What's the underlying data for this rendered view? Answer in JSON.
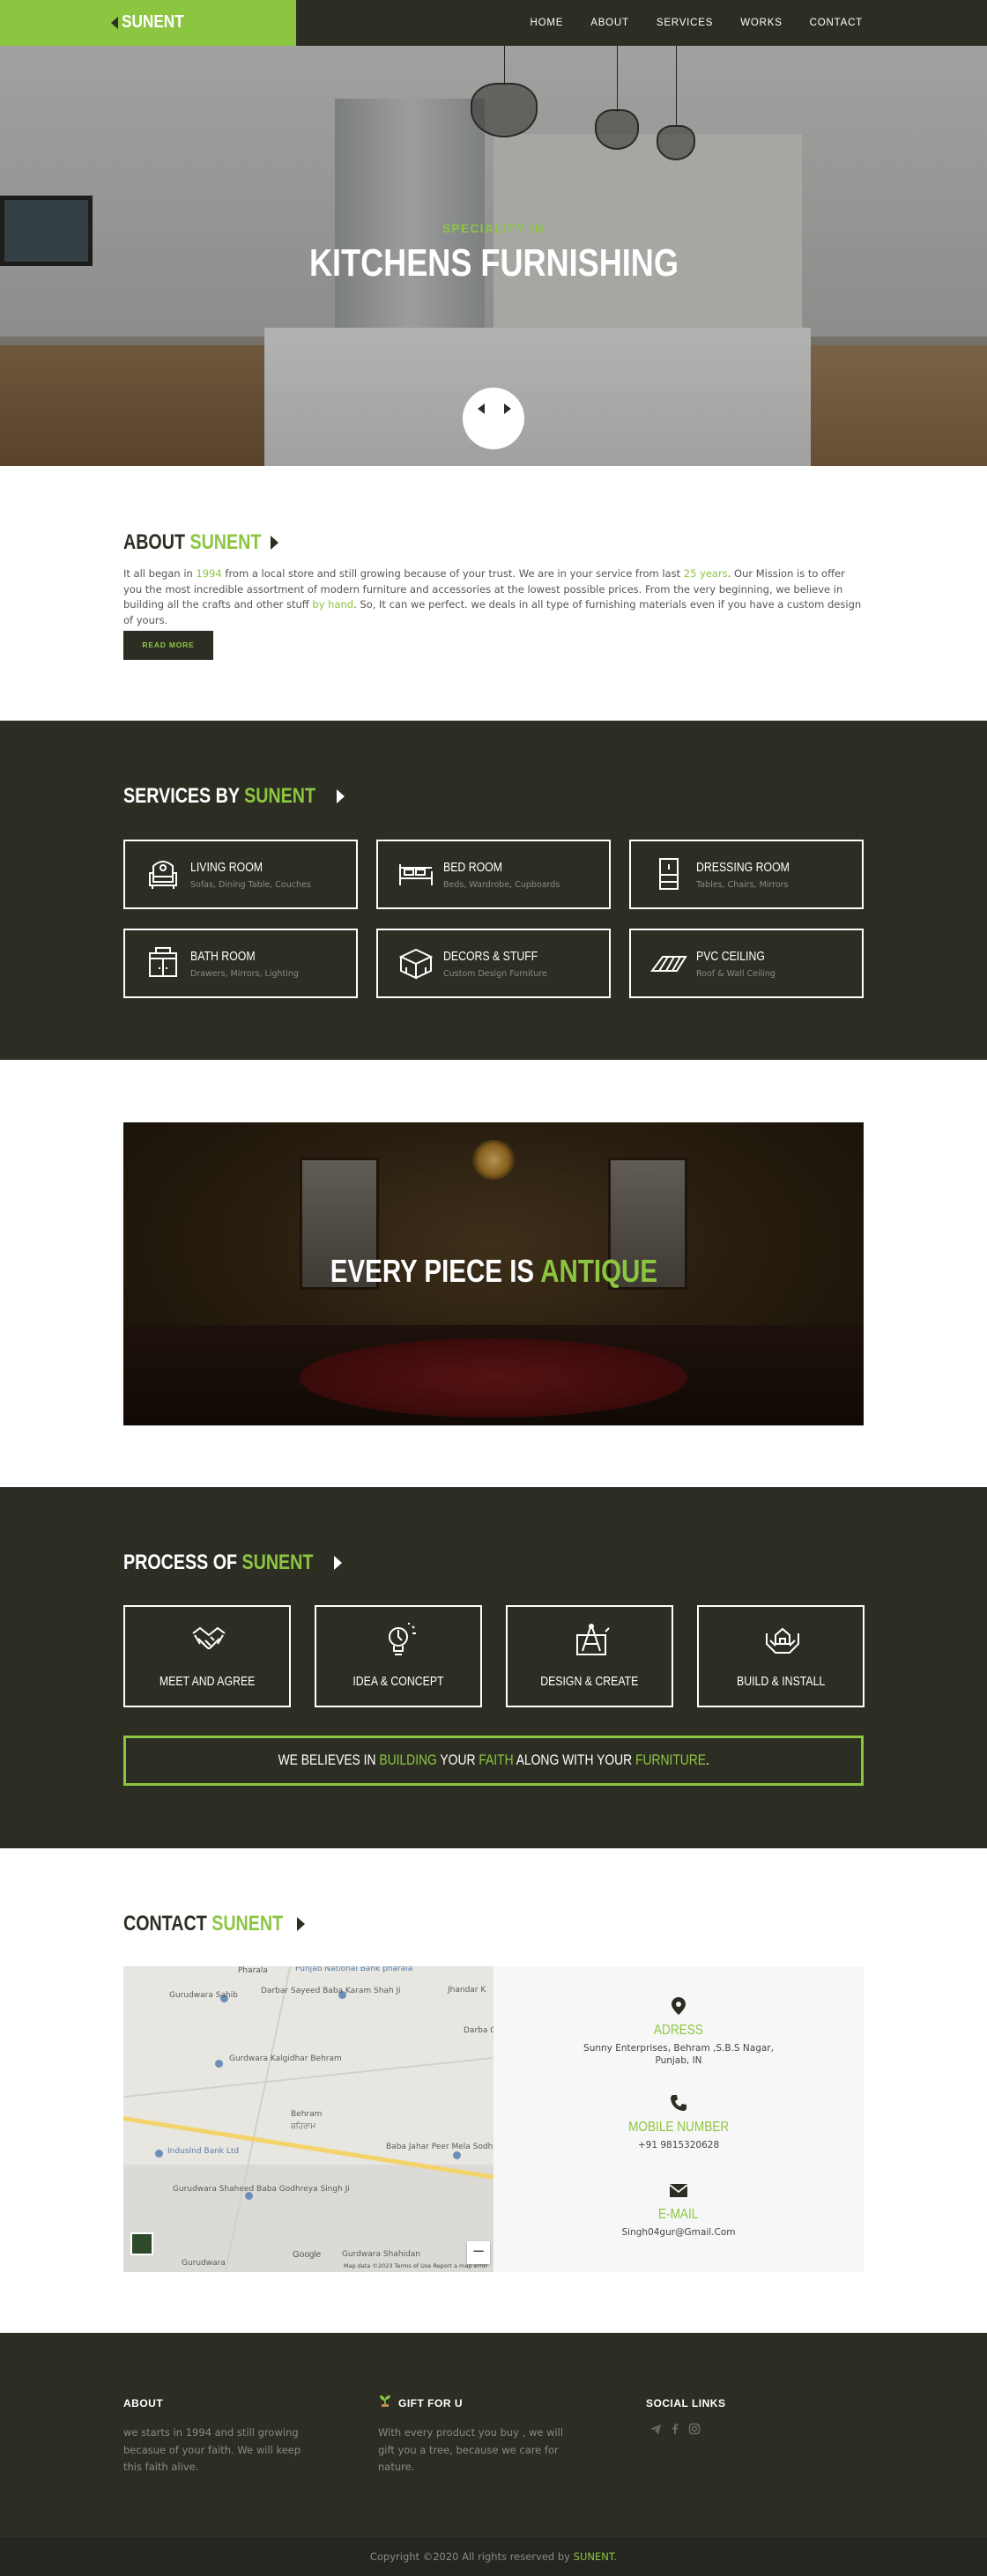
{
  "brand": {
    "name": "SUNENT"
  },
  "nav": {
    "items": [
      "HOME",
      "ABOUT",
      "SERVICES",
      "WORKS",
      "CONTACT"
    ]
  },
  "hero": {
    "subtitle": "SPECIALITY IN",
    "title": "KITCHENS FURNISHING"
  },
  "about": {
    "heading_a": "ABOUT",
    "heading_b": "SUNENT",
    "p1": "It all began in ",
    "year": "1994",
    "p2": " from a local store and still growing because of your trust. We are in your service from last ",
    "years": "25 years",
    "p3": ". Our Mission is to offer you the most incredible assortment of modern furniture and accessories at the lowest possible prices. From the very beginning, we believe in building all the crafts and other stuff ",
    "hand": "by hand",
    "p4": ". So, It can we perfect. we deals in all type of furnishing materials even if you have a custom design of yours.",
    "button": "READ MORE"
  },
  "services": {
    "heading_a": "SERVICES BY",
    "heading_b": "SUNENT",
    "items": [
      {
        "title": "LIVING ROOM",
        "sub": "Sofas, Dining Table, Couches",
        "icon": "sofa-icon"
      },
      {
        "title": "BED ROOM",
        "sub": "Beds, Wardrobe, Cupboards",
        "icon": "bed-icon"
      },
      {
        "title": "DRESSING ROOM",
        "sub": "Tables, Chairs, Mirrors",
        "icon": "wardrobe-icon"
      },
      {
        "title": "BATH ROOM",
        "sub": "Drawers, Mirrors, Lighting",
        "icon": "cabinet-icon"
      },
      {
        "title": "DECORS & STUFF",
        "sub": "Custom Design Furniture",
        "icon": "chest-icon"
      },
      {
        "title": "PVC CEILING",
        "sub": "Roof & Wall Ceiling",
        "icon": "ceiling-icon"
      }
    ]
  },
  "antique": {
    "text_a": "EVERY PIECE IS",
    "text_b": "ANTIQUE"
  },
  "process": {
    "heading_a": "PROCESS OF",
    "heading_b": "SUNENT",
    "items": [
      {
        "title": "MEET AND AGREE",
        "icon": "handshake-icon"
      },
      {
        "title": "IDEA & CONCEPT",
        "icon": "lightbulb-icon"
      },
      {
        "title": "DESIGN & CREATE",
        "icon": "blueprint-icon"
      },
      {
        "title": "BUILD & INSTALL",
        "icon": "hands-house-icon"
      }
    ],
    "believe": {
      "a": "WE BELIEVES IN ",
      "b": "BUILDING",
      "c": " YOUR ",
      "d": "FAITH",
      "e": " ALONG WITH YOUR ",
      "f": "FURNITURE",
      "g": "."
    }
  },
  "contact": {
    "heading_a": "CONTACT",
    "heading_b": "SUNENT",
    "address_label": "ADRESS",
    "address_line1": "Sunny Enterprises, Behram ,S.B.S Nagar,",
    "address_line2": "Punjab, IN",
    "phone_label": "MOBILE NUMBER",
    "phone": "+91 9815320628",
    "email_label": "E-MAIL",
    "email": "Singh04gur@Gmail.Com"
  },
  "map": {
    "labels": {
      "pharala": "Pharala",
      "punjab_bank": "Punjab National Bank pharala",
      "gurudwara1": "Gurudwara Sahib",
      "darbar": "Darbar Sayeed Baba Karam Shah Ji",
      "jhandar": "Jhandar K",
      "darbar2": "Darba Celebra",
      "gurudwara_kalgidhar": "Gurdwara Kalgidhar Behram",
      "behram": "Behram",
      "behram_pa": "ਬਹਿਰਾਮ",
      "indusind": "IndusInd Bank Ltd",
      "jahar": "Baba Jahar Peer Mela Sodhian",
      "shaheed": "Gurudwara Shaheed Baba Godhreya Singh Ji",
      "gurudwara_bottom": "Gurudwara",
      "gurdwara_bottom2": "Gurdwara Shahidan",
      "google": "Google",
      "map_data": "Map data ©2023",
      "terms": "Terms of Use",
      "report": "Report a map error",
      "zoom_out": "−"
    }
  },
  "footer": {
    "about_title": "ABOUT",
    "about_text": "we starts in 1994 and still growing becasue of your faith. We will keep this faith alive.",
    "gift_title": "GIFT FOR U",
    "gift_text": "With every product you buy , we will gift you a tree, because we care for nature.",
    "social_title": "SOCIAL LINKS",
    "copyright_a": "Copyright ©2020 All rights reserved by ",
    "copyright_b": "SUNENT",
    "copyright_c": "."
  },
  "colors": {
    "accent": "#8cc641",
    "dark": "#2d2e23",
    "light_bg": "#f7f7f7"
  }
}
